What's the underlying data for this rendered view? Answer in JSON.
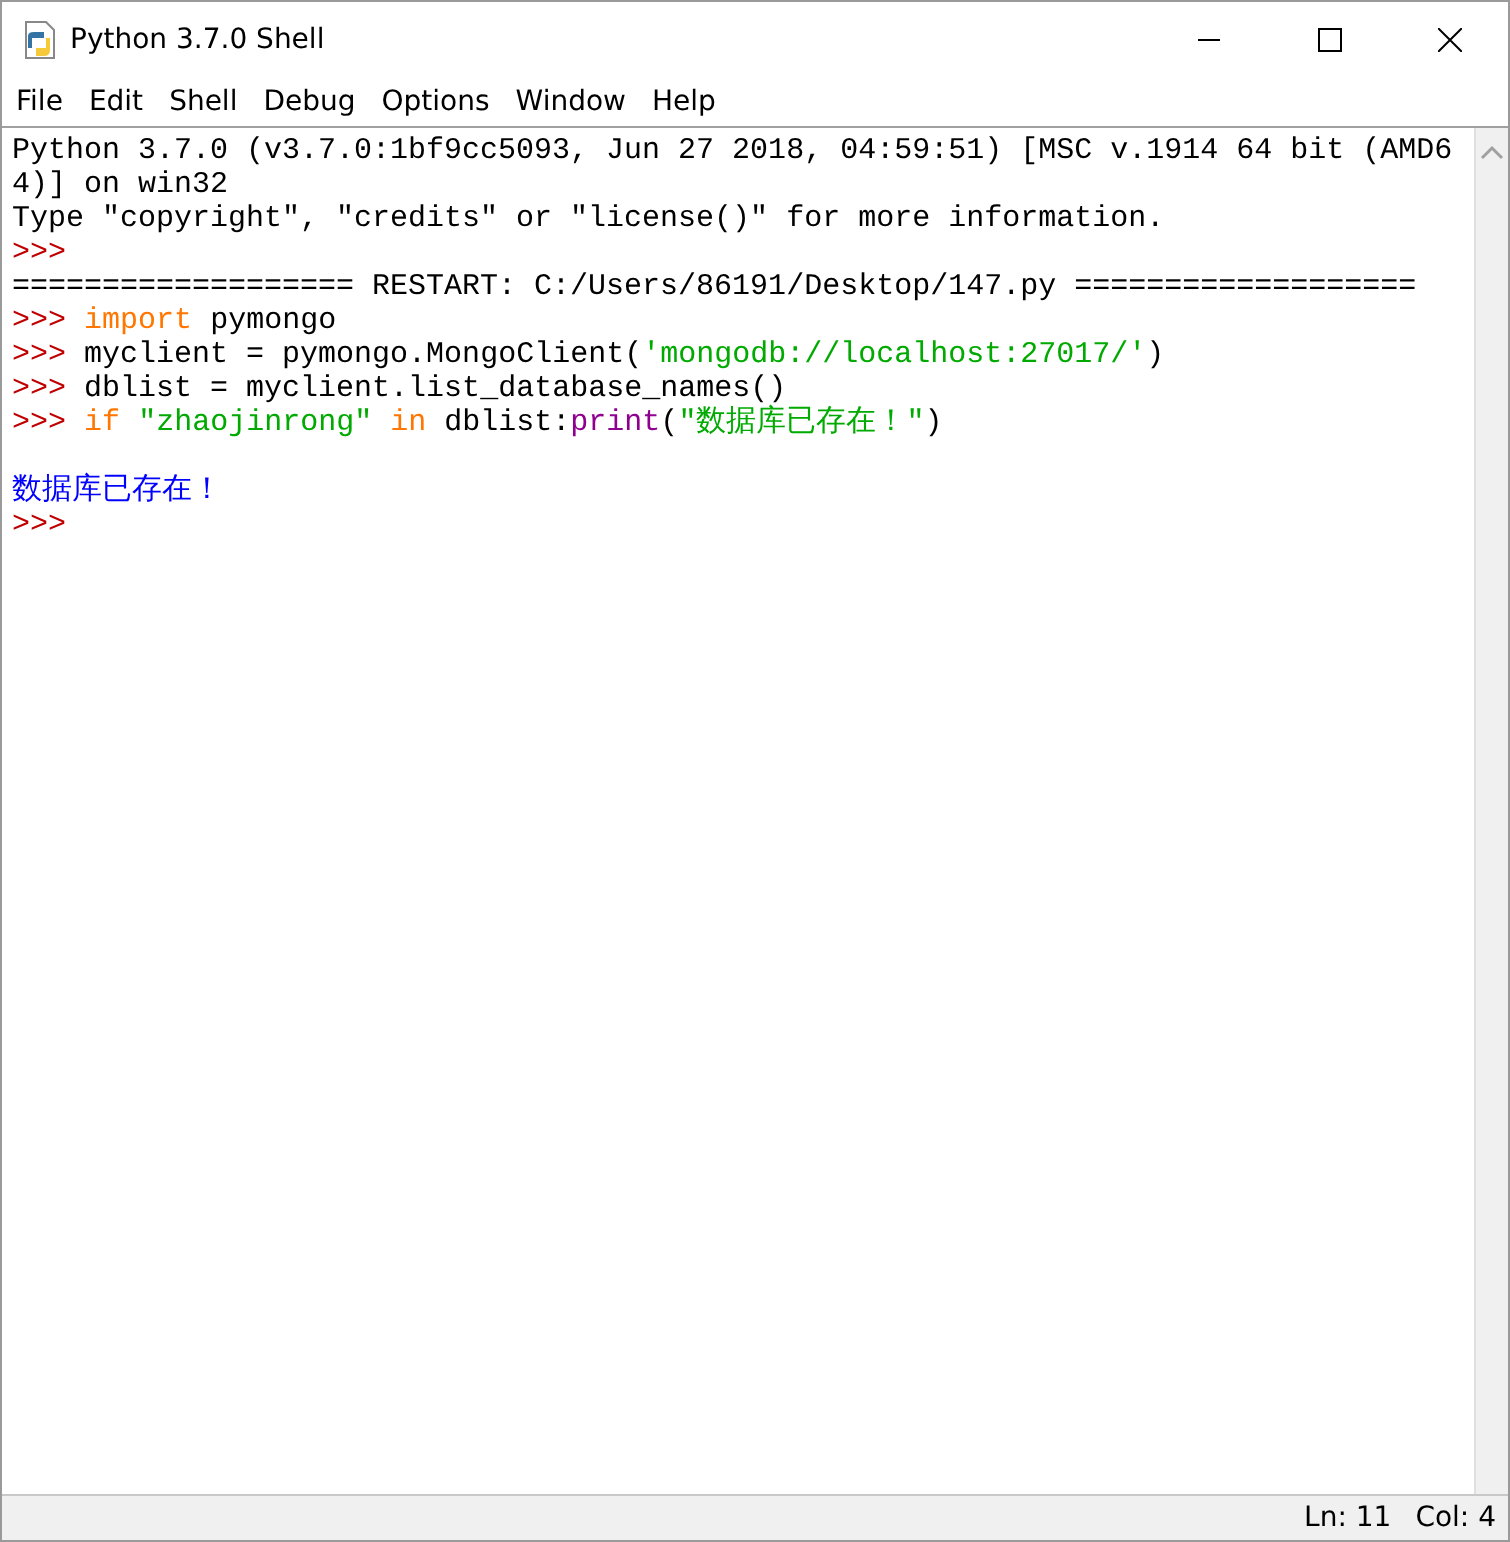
{
  "window": {
    "title": "Python 3.7.0 Shell"
  },
  "menu": [
    "File",
    "Edit",
    "Shell",
    "Debug",
    "Options",
    "Window",
    "Help"
  ],
  "lines": [
    [
      {
        "kind": "output",
        "text": "Python 3.7.0 (v3.7.0:1bf9cc5093, Jun 27 2018, 04:59:51) [MSC v.1914 64 bit (AMD6"
      }
    ],
    [
      {
        "kind": "output",
        "text": "4)] on win32"
      }
    ],
    [
      {
        "kind": "output",
        "text": "Type \"copyright\", \"credits\" or \"license()\" for more information."
      }
    ],
    [
      {
        "kind": "prompt",
        "text": ">>>"
      }
    ],
    [
      {
        "kind": "output",
        "text": "=================== RESTART: C:/Users/86191/Desktop/147.py ==================="
      }
    ],
    [
      {
        "kind": "prompt",
        "text": ">>>"
      },
      {
        "kind": "keyword",
        "text": "import"
      },
      {
        "kind": "plain",
        "text": "pymongo"
      }
    ],
    [
      {
        "kind": "prompt",
        "text": ">>>"
      },
      {
        "kind": "plain",
        "text": "myclient = pymongo.MongoClient("
      },
      {
        "kind": "string",
        "text": "'mongodb://localhost:27017/'"
      },
      {
        "kind": "plain",
        "text": ")"
      }
    ],
    [
      {
        "kind": "prompt",
        "text": ">>>"
      },
      {
        "kind": "plain",
        "text": "dblist = myclient.list_database_names()"
      }
    ],
    [
      {
        "kind": "prompt",
        "text": ">>>"
      },
      {
        "kind": "keyword",
        "text": "if"
      },
      {
        "kind": "string",
        "text": "\"zhaojinrong\""
      },
      {
        "kind": "keyword",
        "text": "in"
      },
      {
        "kind": "plain",
        "text": "dblist:"
      },
      {
        "kind": "builtin",
        "text": "print"
      },
      {
        "kind": "plain",
        "text": "("
      },
      {
        "kind": "string",
        "text": "\"数据库已存在！\""
      },
      {
        "kind": "plain",
        "text": ")"
      }
    ],
    [
      {
        "kind": "blank"
      }
    ],
    [
      {
        "kind": "stdout",
        "text": "数据库已存在！"
      }
    ],
    [
      {
        "kind": "prompt",
        "text": ">>>"
      }
    ]
  ],
  "status_bar": {
    "line": "Ln: 11",
    "column": "Col: 4"
  }
}
